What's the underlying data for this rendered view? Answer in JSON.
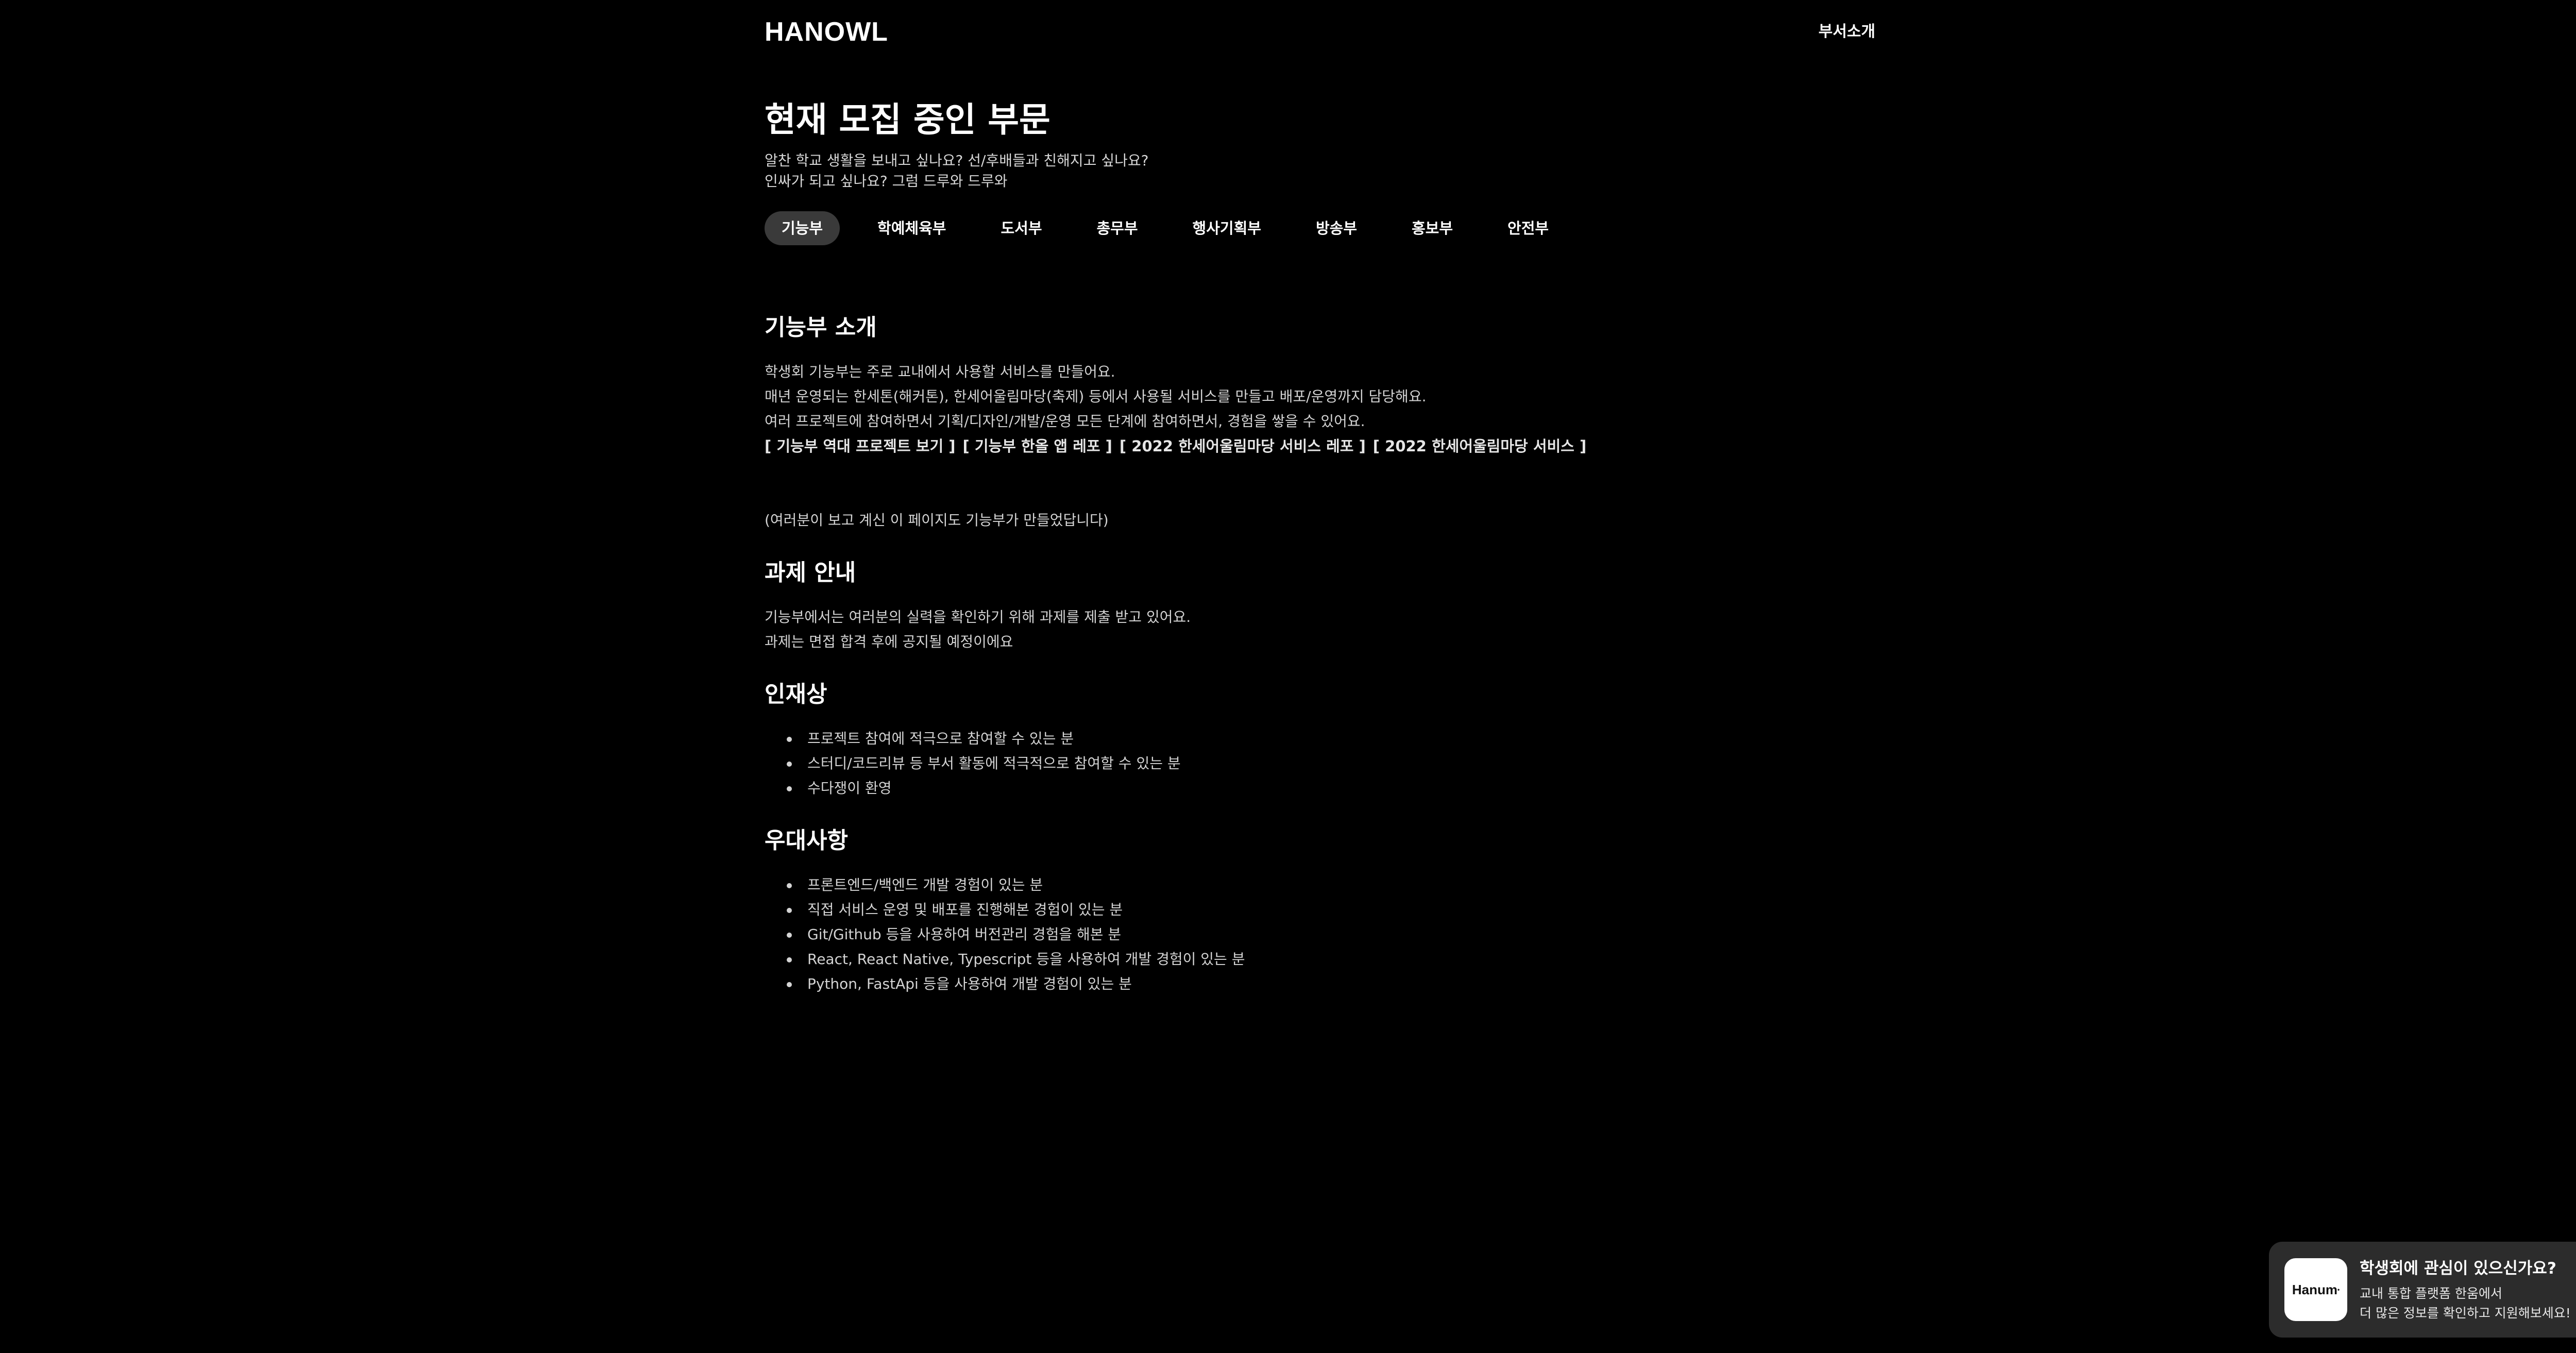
{
  "header": {
    "logo": "HANOWL",
    "nav_link": "부서소개"
  },
  "page": {
    "title": "현재 모집 중인 부문",
    "subtitle_lines": [
      "알찬 학교 생활을 보내고 싶나요? 선/후배들과 친해지고 싶나요?",
      "인싸가 되고 싶나요? 그럼 드루와 드루와"
    ]
  },
  "tabs": [
    {
      "label": "기능부",
      "active": true
    },
    {
      "label": "학예체육부",
      "active": false
    },
    {
      "label": "도서부",
      "active": false
    },
    {
      "label": "총무부",
      "active": false
    },
    {
      "label": "행사기획부",
      "active": false
    },
    {
      "label": "방송부",
      "active": false
    },
    {
      "label": "홍보부",
      "active": false
    },
    {
      "label": "안전부",
      "active": false
    }
  ],
  "intro": {
    "title": "기능부 소개",
    "lines": [
      "학생회 기능부는 주로 교내에서 사용할 서비스를 만들어요.",
      "매년 운영되는 한세톤(해커톤), 한세어울림마당(축제) 등에서 사용될 서비스를 만들고 배포/운영까지 담당해요.",
      "여러 프로젝트에 참여하면서 기획/디자인/개발/운영 모든 단계에 참여하면서, 경험을 쌓을 수 있어요."
    ],
    "links": [
      "[ 기능부 역대 프로젝트 보기 ]",
      "[ 기능부 한올 앱 레포 ]",
      "[ 2022 한세어울림마당 서비스 레포 ]",
      "[ 2022 한세어울림마당 서비스 ]"
    ],
    "note": "(여러분이 보고 계신 이 페이지도 기능부가 만들었답니다)"
  },
  "assignment": {
    "title": "과제 안내",
    "lines": [
      "기능부에서는 여러분의 실력을 확인하기 위해 과제를 제출 받고 있어요.",
      "과제는 면접 합격 후에 공지될 예정이에요"
    ]
  },
  "talent": {
    "title": "인재상",
    "items": [
      "프로젝트 참여에 적극으로 참여할 수 있는 분",
      "스터디/코드리뷰 등 부서 활동에 적극적으로 참여할 수 있는 분",
      "수다쟁이 환영"
    ]
  },
  "preference": {
    "title": "우대사항",
    "items": [
      "프론트엔드/백엔드 개발 경험이 있는 분",
      "직접 서비스 운영 및 배포를 진행해본 경험이 있는 분",
      "Git/Github 등을 사용하여 버전관리 경험을 해본 분",
      "React, React Native, Typescript 등을 사용하여 개발 경험이 있는 분",
      "Python, FastApi 등을 사용하여 개발 경험이 있는 분"
    ]
  },
  "promo": {
    "logo_text": "Hanum",
    "title": "학생회에 관심이 있으신가요?",
    "desc_lines": [
      "교내 통합 플랫폼 한움에서",
      "더 많은 정보를 확인하고 지원해보세요!"
    ],
    "close_icon": "close-icon"
  },
  "colors": {
    "background": "#000000",
    "text": "#ffffff",
    "muted_text": "#d4d4d4",
    "active_tab": "#3a3a3a",
    "promo_bg": "#2c2c2c"
  }
}
